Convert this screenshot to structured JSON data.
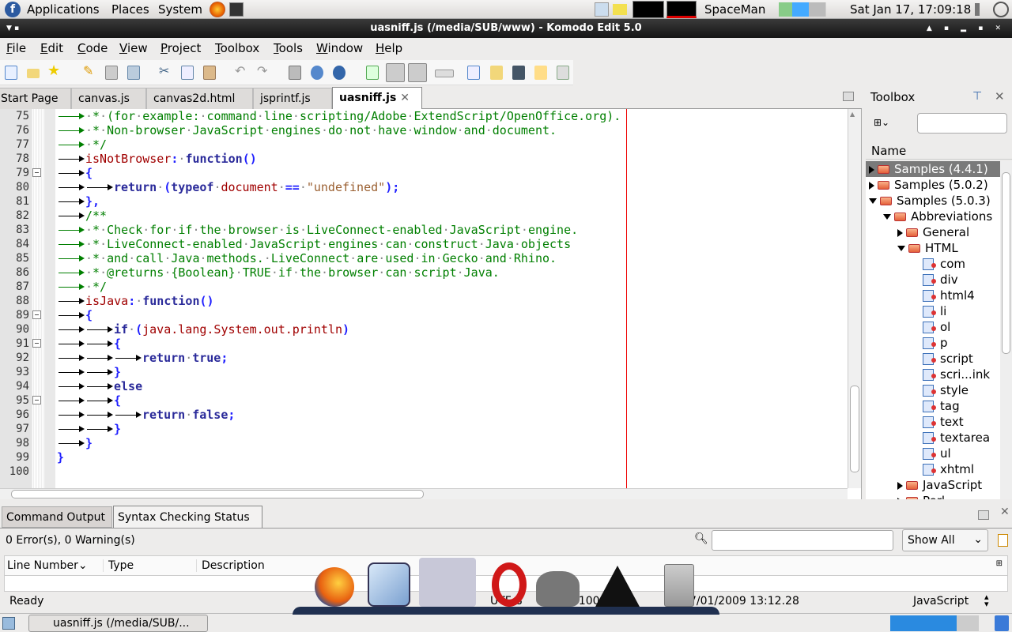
{
  "panel": {
    "menus": [
      "Applications",
      "Places",
      "System"
    ],
    "user": "SpaceMan",
    "clock": "Sat Jan 17, 17:09:18"
  },
  "window": {
    "title": "uasniff.js (/media/SUB/www) - Komodo Edit 5.0"
  },
  "menubar": [
    "File",
    "Edit",
    "Code",
    "View",
    "Project",
    "Toolbox",
    "Tools",
    "Window",
    "Help"
  ],
  "tabs": [
    {
      "label": "Start Page"
    },
    {
      "label": "canvas.js"
    },
    {
      "label": "canvas2d.html"
    },
    {
      "label": "jsprintf.js"
    },
    {
      "label": "uasniff.js",
      "active": true
    }
  ],
  "editor": {
    "first_line": 75,
    "lines": [
      [
        [
          1,
          "c"
        ],
        [
          "c",
          " * (for example: command line scripting/Adobe ExtendScript/OpenOffice.org)."
        ]
      ],
      [
        [
          1,
          "c"
        ],
        [
          "c",
          " * Non-browser JavaScript engines do not have window and document."
        ]
      ],
      [
        [
          1,
          "c"
        ],
        [
          "c",
          " */"
        ]
      ],
      [
        [
          1
        ],
        [
          "id",
          "isNotBrowser"
        ],
        [
          "op",
          ":"
        ],
        [
          "p",
          " "
        ],
        [
          "k",
          "function"
        ],
        [
          "op",
          "()"
        ]
      ],
      [
        [
          1
        ],
        [
          "op",
          "{"
        ]
      ],
      [
        [
          2
        ],
        [
          "k",
          "return"
        ],
        [
          "p",
          " "
        ],
        [
          "op",
          "("
        ],
        [
          "k",
          "typeof"
        ],
        [
          "p",
          " "
        ],
        [
          "id",
          "document"
        ],
        [
          "p",
          " "
        ],
        [
          "op",
          "=="
        ],
        [
          "p",
          " "
        ],
        [
          "s",
          "\"undefined\""
        ],
        [
          "op",
          ");"
        ]
      ],
      [
        [
          1
        ],
        [
          "op",
          "},"
        ]
      ],
      [
        [
          1
        ],
        [
          "c",
          "/**"
        ]
      ],
      [
        [
          1,
          "c"
        ],
        [
          "c",
          " * Check for if the browser is LiveConnect-enabled JavaScript engine."
        ]
      ],
      [
        [
          1,
          "c"
        ],
        [
          "c",
          " * LiveConnect-enabled JavaScript engines can construct Java objects"
        ]
      ],
      [
        [
          1,
          "c"
        ],
        [
          "c",
          " * and call Java methods. LiveConnect are used in Gecko and Rhino."
        ]
      ],
      [
        [
          1,
          "c"
        ],
        [
          "c",
          " * @returns {Boolean} TRUE if the browser can script Java."
        ]
      ],
      [
        [
          1,
          "c"
        ],
        [
          "c",
          " */"
        ]
      ],
      [
        [
          1
        ],
        [
          "id",
          "isJava"
        ],
        [
          "op",
          ":"
        ],
        [
          "p",
          " "
        ],
        [
          "k",
          "function"
        ],
        [
          "op",
          "()"
        ]
      ],
      [
        [
          1
        ],
        [
          "op",
          "{"
        ]
      ],
      [
        [
          2
        ],
        [
          "k",
          "if"
        ],
        [
          "p",
          " "
        ],
        [
          "op",
          "("
        ],
        [
          "id",
          "java.lang.System.out.println"
        ],
        [
          "op",
          ")"
        ]
      ],
      [
        [
          2
        ],
        [
          "op",
          "{"
        ]
      ],
      [
        [
          3
        ],
        [
          "k",
          "return"
        ],
        [
          "p",
          " "
        ],
        [
          "k",
          "true"
        ],
        [
          "op",
          ";"
        ]
      ],
      [
        [
          2
        ],
        [
          "op",
          "}"
        ]
      ],
      [
        [
          2
        ],
        [
          "k",
          "else"
        ]
      ],
      [
        [
          2
        ],
        [
          "op",
          "{"
        ]
      ],
      [
        [
          3
        ],
        [
          "k",
          "return"
        ],
        [
          "p",
          " "
        ],
        [
          "k",
          "false"
        ],
        [
          "op",
          ";"
        ]
      ],
      [
        [
          2
        ],
        [
          "op",
          "}"
        ]
      ],
      [
        [
          1
        ],
        [
          "op",
          "}"
        ]
      ],
      [
        [
          0
        ],
        [
          "op",
          "}"
        ]
      ],
      [
        [
          0
        ]
      ]
    ],
    "fold_lines": [
      79,
      89,
      91,
      95
    ]
  },
  "toolbox": {
    "title": "Toolbox",
    "filter_value": "",
    "column": "Name",
    "items": [
      {
        "label": "Samples (4.4.1)",
        "kind": "folder",
        "depth": 0,
        "open": false,
        "selected": true
      },
      {
        "label": "Samples (5.0.2)",
        "kind": "folder",
        "depth": 0,
        "open": false
      },
      {
        "label": "Samples (5.0.3)",
        "kind": "folder",
        "depth": 0,
        "open": true
      },
      {
        "label": "Abbreviations",
        "kind": "folder",
        "depth": 1,
        "open": true
      },
      {
        "label": "General",
        "kind": "folder",
        "depth": 2,
        "open": false
      },
      {
        "label": "HTML",
        "kind": "folder",
        "depth": 2,
        "open": true
      },
      {
        "label": "com",
        "kind": "snippet",
        "depth": 3
      },
      {
        "label": "div",
        "kind": "snippet",
        "depth": 3
      },
      {
        "label": "html4",
        "kind": "snippet",
        "depth": 3
      },
      {
        "label": "li",
        "kind": "snippet",
        "depth": 3
      },
      {
        "label": "ol",
        "kind": "snippet",
        "depth": 3
      },
      {
        "label": "p",
        "kind": "snippet",
        "depth": 3
      },
      {
        "label": "script",
        "kind": "snippet",
        "depth": 3
      },
      {
        "label": "scri...ink",
        "kind": "snippet",
        "depth": 3
      },
      {
        "label": "style",
        "kind": "snippet",
        "depth": 3
      },
      {
        "label": "tag",
        "kind": "snippet",
        "depth": 3
      },
      {
        "label": "text",
        "kind": "snippet",
        "depth": 3
      },
      {
        "label": "textarea",
        "kind": "snippet",
        "depth": 3
      },
      {
        "label": "ul",
        "kind": "snippet",
        "depth": 3
      },
      {
        "label": "xhtml",
        "kind": "snippet",
        "depth": 3
      },
      {
        "label": "JavaScript",
        "kind": "folder",
        "depth": 2,
        "open": false
      },
      {
        "label": "Perl",
        "kind": "folder",
        "depth": 2,
        "open": false
      }
    ]
  },
  "bottom": {
    "tabs": [
      "Command Output",
      "Syntax Checking Status"
    ],
    "active_tab": "Syntax Checking Status",
    "summary": "0 Error(s), 0 Warning(s)",
    "search_value": "",
    "filter": "Show All",
    "columns": [
      "Line Number",
      "Type",
      "Description"
    ]
  },
  "status": {
    "message": "Ready",
    "encoding": "UTF-8",
    "position": "Ln: 100",
    "date": "7/01/2009 13:12.28",
    "language": "JavaScript"
  },
  "taskbar": {
    "window_button": "uasniff.js (/media/SUB/..."
  },
  "dock": [
    "firefox-icon",
    "virtualbox-icon",
    "komodo-icon",
    "opera-icon",
    "gimp-icon",
    "inkscape-icon",
    "file-cabinet-icon"
  ],
  "colors": {
    "comment": "#007f00",
    "keyword": "#2a2a9a",
    "identifier": "#a00000",
    "operator": "#2020ff",
    "string": "#9a5f30",
    "edge_line": "#ee0000"
  }
}
